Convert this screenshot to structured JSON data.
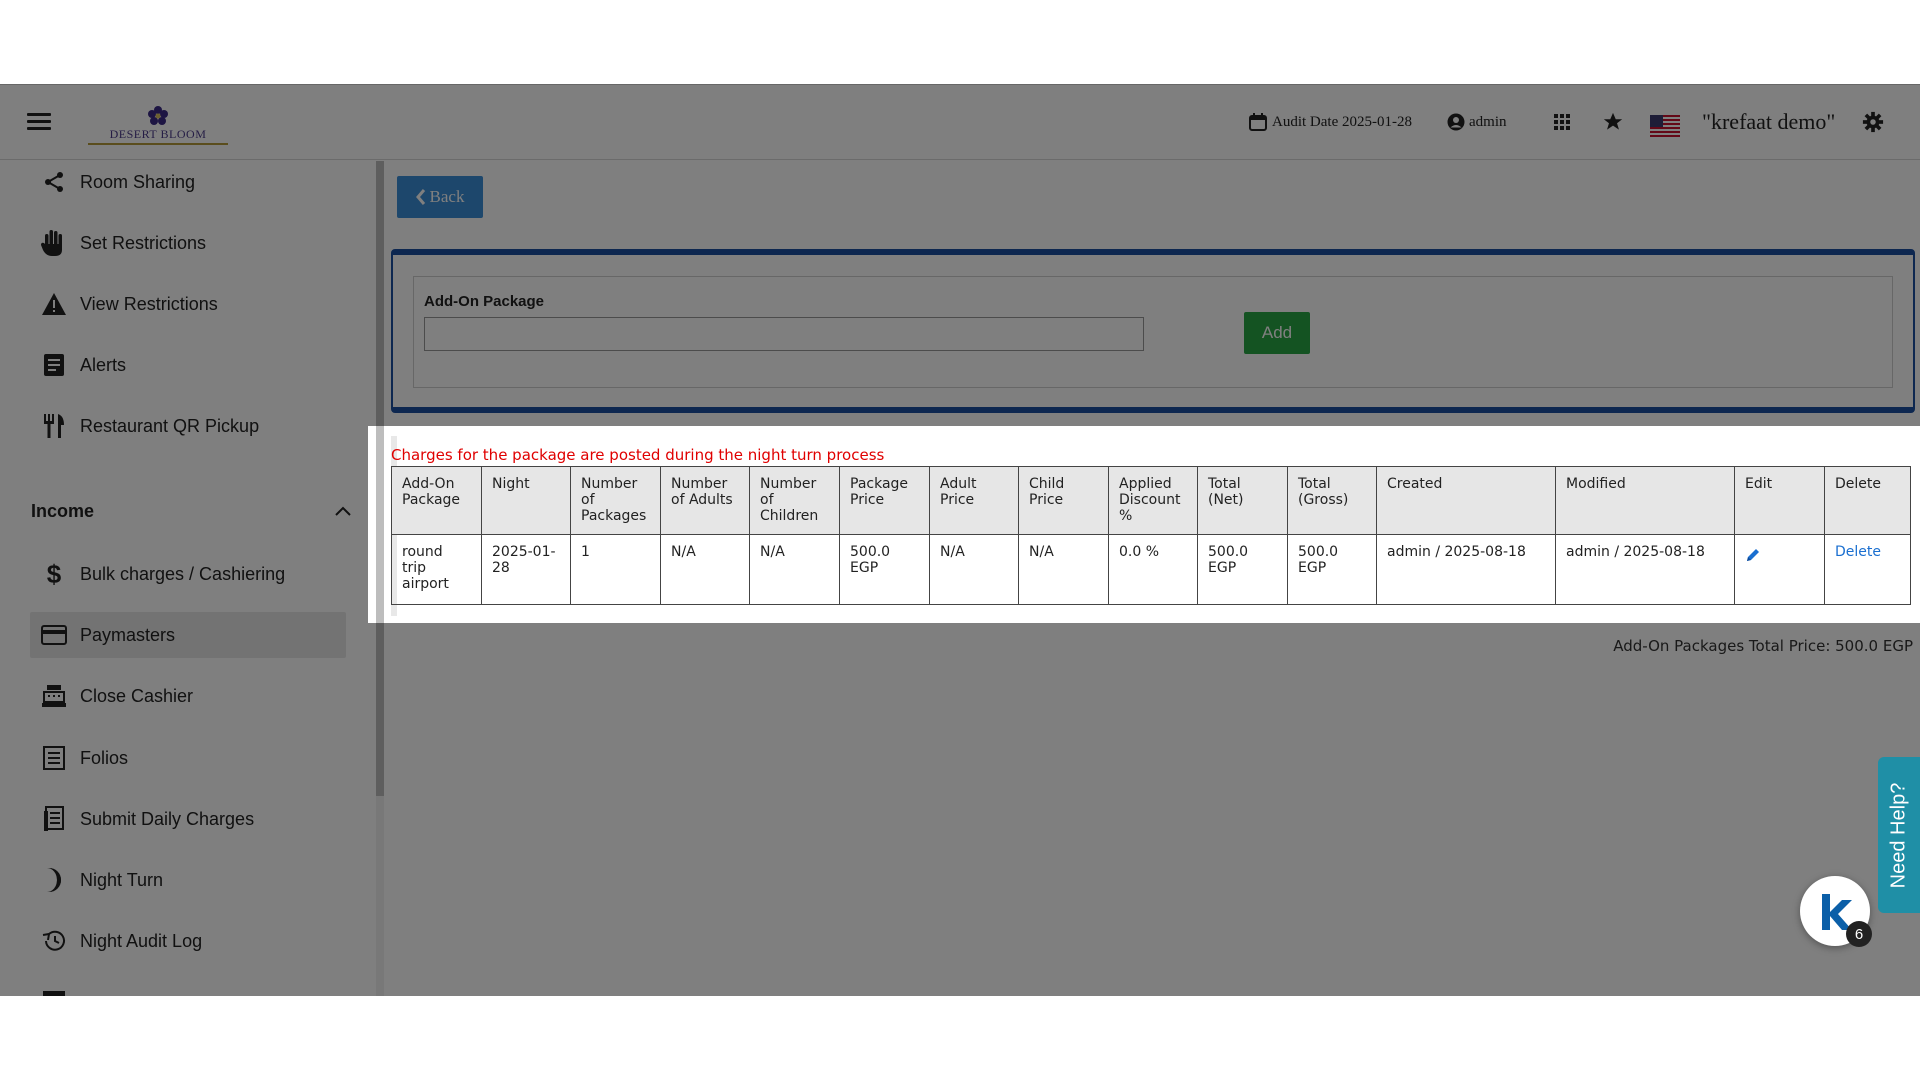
{
  "header": {
    "logo_text": "DESERT BLOOM",
    "audit_date": "Audit Date 2025-01-28",
    "user": "admin",
    "hotel_name": "\"krefaat demo\""
  },
  "sidebar": {
    "items_top": [
      {
        "label": "Room Sharing",
        "icon": "share-icon"
      },
      {
        "label": "Set Restrictions",
        "icon": "hand-icon"
      },
      {
        "label": "View Restrictions",
        "icon": "warning-icon"
      },
      {
        "label": "Alerts",
        "icon": "document-icon"
      },
      {
        "label": "Restaurant QR Pickup",
        "icon": "utensils-icon"
      }
    ],
    "section_title": "Income",
    "items_income": [
      {
        "label": "Bulk charges / Cashiering",
        "icon": "dollar-icon"
      },
      {
        "label": "Paymasters",
        "icon": "card-icon",
        "active": true
      },
      {
        "label": "Close Cashier",
        "icon": "cash-register-icon"
      },
      {
        "label": "Folios",
        "icon": "list-icon"
      },
      {
        "label": "Submit Daily Charges",
        "icon": "receipt-icon"
      },
      {
        "label": "Night Turn",
        "icon": "moon-icon"
      },
      {
        "label": "Night Audit Log",
        "icon": "history-icon"
      }
    ]
  },
  "main": {
    "back_label": "Back",
    "addon_label": "Add-On Package",
    "addon_value": "",
    "add_label": "Add",
    "notice": "Charges for the package are posted during the night turn process",
    "table": {
      "columns": [
        "Add-On Package",
        "Night",
        "Number of Packages",
        "Number of Adults",
        "Number of Children",
        "Package Price",
        "Adult Price",
        "Child Price",
        "Applied Discount %",
        "Total (Net)",
        "Total (Gross)",
        "Created",
        "Modified",
        "Edit",
        "Delete"
      ],
      "rows": [
        {
          "package": "round trip airport",
          "night": "2025-01-28",
          "num_packages": "1",
          "num_adults": "N/A",
          "num_children": "N/A",
          "package_price": "500.0 EGP",
          "adult_price": "N/A",
          "child_price": "N/A",
          "discount": "0.0 %",
          "total_net": "500.0 EGP",
          "total_gross": "500.0 EGP",
          "created": "admin / 2025-08-18",
          "modified": "admin / 2025-08-18",
          "delete_label": "Delete"
        }
      ]
    },
    "total_line": "Add-On Packages Total Price: 500.0 EGP"
  },
  "help_label": "Need Help?",
  "chat_badge": "6",
  "colors": {
    "primary": "#3a8fd9",
    "success": "#28a745",
    "panel_border": "#1a4fa0",
    "notice": "#e00000",
    "help": "#1f8fa6"
  }
}
